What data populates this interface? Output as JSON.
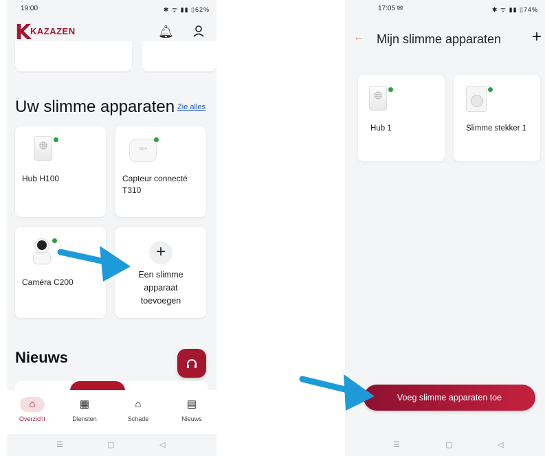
{
  "left": {
    "status": {
      "time": "19:00",
      "icons": "✱ ᯤ ▮▮ ▯62%"
    },
    "header": {
      "logo_letter": "K",
      "logo_text": "KAZAZEN",
      "bell_icon": "bell-icon",
      "user_icon": "user-icon"
    },
    "section_title": "Uw slimme apparaten",
    "see_all": "Zie alles",
    "devices": [
      {
        "name": "Hub H100",
        "icon": "hub-icon",
        "online": true
      },
      {
        "name": "Capteur connecté T310",
        "icon": "sensor-icon",
        "online": true,
        "brand_mark": "tapo"
      },
      {
        "name": "Caméra C200",
        "icon": "camera-icon",
        "online": true
      }
    ],
    "add_device": {
      "plus": "+",
      "label": "Een slimme apparaat toevoegen"
    },
    "news_title": "Nieuws",
    "support_icon": "headset-icon",
    "nav": [
      {
        "label": "Overzicht",
        "icon": "home-icon",
        "active": true
      },
      {
        "label": "Diensten",
        "icon": "store-icon",
        "active": false
      },
      {
        "label": "Schade",
        "icon": "house-damage-icon",
        "active": false
      },
      {
        "label": "Nieuws",
        "icon": "newspaper-icon",
        "active": false
      }
    ],
    "sysnav": {
      "menu": "☰",
      "home": "▢",
      "back": "◁"
    }
  },
  "right": {
    "status": {
      "time": "17:05 ✉",
      "icons": "✱ ᯤ ▮▮ ▯74%"
    },
    "title": "Mijn slimme apparaten",
    "back_glyph": "←",
    "add_glyph": "+",
    "devices": [
      {
        "name": "Hub 1",
        "icon": "hub-icon",
        "online": true
      },
      {
        "name": "Slimme stekker 1",
        "icon": "smart-plug-icon",
        "online": true
      }
    ],
    "cta_label": "Voeg slimme apparaten toe",
    "sysnav": {
      "menu": "☰",
      "home": "▢",
      "back": "◁"
    }
  },
  "colors": {
    "brand": "#a3172f",
    "online": "#2ea043",
    "arrow": "#1c9bd8",
    "back_arrow": "#e8855d"
  }
}
